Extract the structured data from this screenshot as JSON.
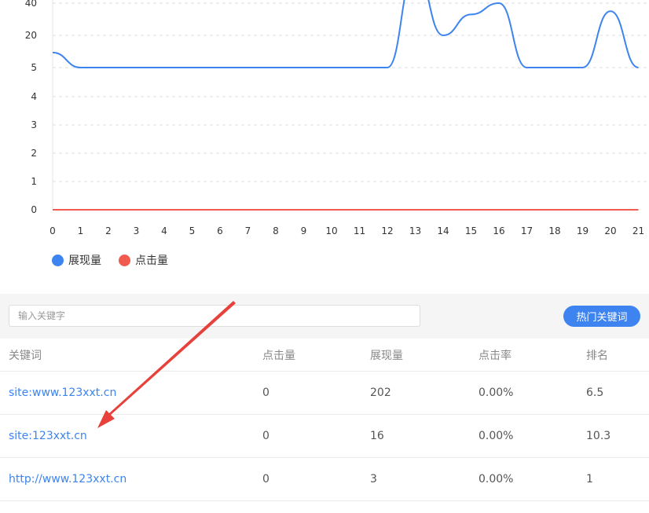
{
  "chart_data": {
    "type": "line",
    "x": [
      0,
      1,
      2,
      3,
      4,
      5,
      6,
      7,
      8,
      9,
      10,
      11,
      12,
      13,
      14,
      15,
      16,
      17,
      18,
      19,
      20,
      21
    ],
    "y_ticks": [
      "0",
      "1",
      "2",
      "3",
      "4",
      "5",
      "20",
      "40"
    ],
    "series": [
      {
        "name": "展现量",
        "color": "#3d84f0",
        "values": [
          12,
          5,
          5,
          5,
          5,
          5,
          5,
          5,
          5,
          5,
          5,
          5,
          5,
          60,
          20,
          33,
          40,
          5,
          5,
          5,
          35,
          5
        ]
      },
      {
        "name": "点击量",
        "color": "#f05a4f",
        "values": [
          0,
          0,
          0,
          0,
          0,
          0,
          0,
          0,
          0,
          0,
          0,
          0,
          0,
          0,
          0,
          0,
          0,
          0,
          0,
          0,
          0,
          0
        ]
      }
    ]
  },
  "legend": {
    "impressions": "展现量",
    "clicks": "点击量",
    "impressions_color": "#3d84f0",
    "clicks_color": "#f05a4f"
  },
  "search": {
    "placeholder": "输入关键字",
    "value": "",
    "hot_button": "热门关键词"
  },
  "table": {
    "headers": [
      "关键词",
      "点击量",
      "展现量",
      "点击率",
      "排名"
    ],
    "rows": [
      [
        "site:www.123xxt.cn",
        "0",
        "202",
        "0.00%",
        "6.5"
      ],
      [
        "site:123xxt.cn",
        "0",
        "16",
        "0.00%",
        "10.3"
      ],
      [
        "http://www.123xxt.cn",
        "0",
        "3",
        "0.00%",
        "1"
      ]
    ]
  },
  "annotation": {
    "arrow_color": "#e8403a"
  }
}
